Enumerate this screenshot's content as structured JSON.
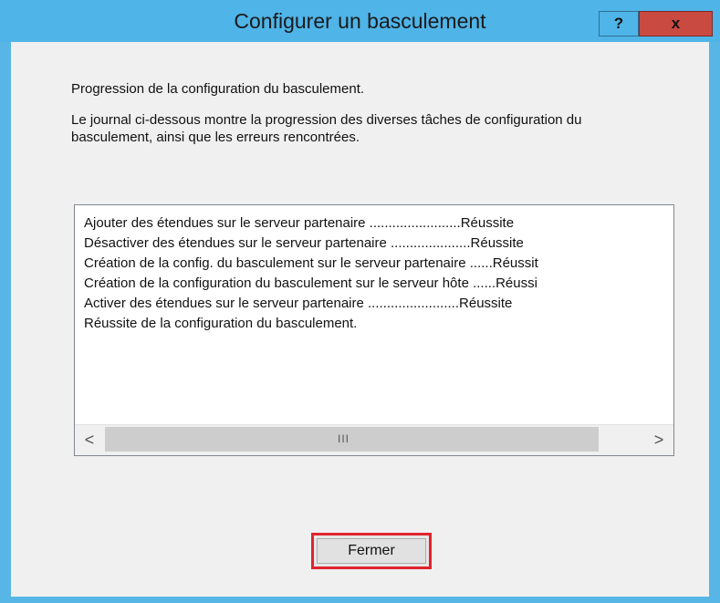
{
  "window": {
    "title": "Configurer un basculement",
    "help_glyph": "?",
    "close_glyph": "x"
  },
  "content": {
    "heading": "Progression de la configuration du basculement.",
    "description": "Le journal ci-dessous montre la progression des diverses tâches de configuration du basculement, ainsi que les erreurs rencontrées."
  },
  "log": {
    "lines": [
      "Ajouter des étendues sur le serveur partenaire ........................Réussite",
      "Désactiver des étendues sur le serveur partenaire .....................Réussite",
      "Création de la config. du basculement sur le serveur partenaire ......Réussit",
      "Création de la configuration du basculement sur le serveur hôte ......Réussi",
      "Activer des étendues sur le serveur partenaire ........................Réussite",
      "Réussite de la configuration du basculement."
    ],
    "scroll_left_glyph": "<",
    "scroll_right_glyph": ">",
    "scroll_thumb_glyph": "III"
  },
  "footer": {
    "close_button_label": "Fermer"
  },
  "colors": {
    "titlebar": "#4fb4e8",
    "close_button_bg": "#c94a40",
    "highlight": "#e0242f"
  }
}
